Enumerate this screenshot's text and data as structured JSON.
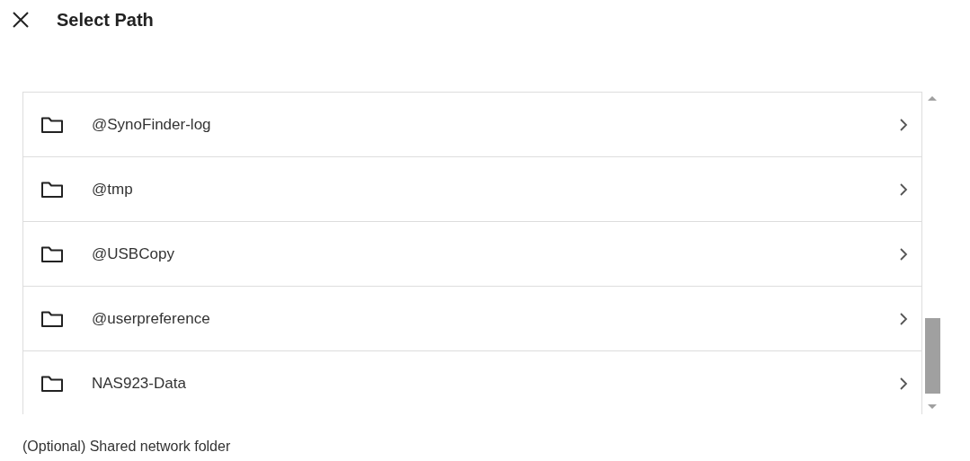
{
  "dialog": {
    "title": "Select Path"
  },
  "folders": [
    {
      "name": "@SynoFinder-log"
    },
    {
      "name": "@tmp"
    },
    {
      "name": "@USBCopy"
    },
    {
      "name": "@userpreference"
    },
    {
      "name": "NAS923-Data"
    }
  ],
  "next_field": {
    "label": "(Optional) Shared network folder"
  }
}
